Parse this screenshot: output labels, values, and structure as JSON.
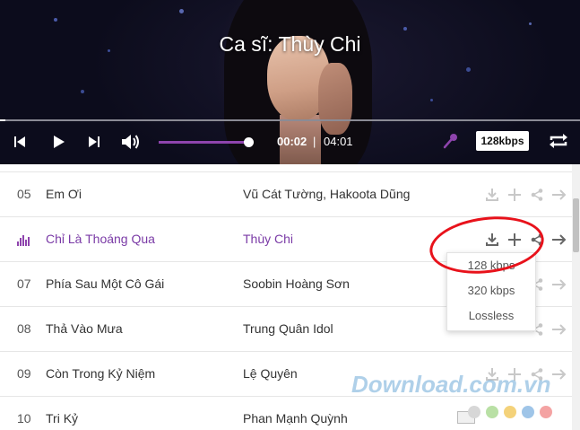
{
  "player": {
    "title": "Ca sĩ: Thùy Chi",
    "current_time": "00:02",
    "separator": "|",
    "total_time": "04:01",
    "quality": "128kbps",
    "progress": 0.01,
    "volume": 1.0
  },
  "icons": {
    "prev": "skip-previous-icon",
    "play": "play-icon",
    "next": "skip-next-icon",
    "volume": "volume-icon",
    "mic": "microphone-icon",
    "repeat": "repeat-icon",
    "download": "download-icon",
    "add": "plus-icon",
    "share": "share-icon",
    "forward": "arrow-right-icon",
    "playing": "equalizer-icon"
  },
  "colors": {
    "accent": "#8e44ad",
    "active_text": "#7a3aa6",
    "highlight": "#e8121b"
  },
  "tracks": [
    {
      "num": "05",
      "name": "Em Ơi",
      "artist": "Vũ Cát Tường, Hakoota Dũng",
      "playing": false
    },
    {
      "num": "",
      "name": "Chỉ Là Thoáng Qua",
      "artist": "Thùy Chi",
      "playing": true
    },
    {
      "num": "07",
      "name": "Phía Sau Một Cô Gái",
      "artist": "Soobin Hoàng Sơn",
      "playing": false
    },
    {
      "num": "08",
      "name": "Thả Vào Mưa",
      "artist": "Trung Quân Idol",
      "playing": false
    },
    {
      "num": "09",
      "name": "Còn Trong Kỷ Niệm",
      "artist": "Lệ Quyên",
      "playing": false
    },
    {
      "num": "10",
      "name": "Tri Kỷ",
      "artist": "Phan Mạnh Quỳnh",
      "playing": false
    }
  ],
  "download_menu": {
    "options": [
      "128 kbps",
      "320 kbps",
      "Lossless"
    ]
  },
  "watermark": {
    "text": "Download.com.vn"
  }
}
